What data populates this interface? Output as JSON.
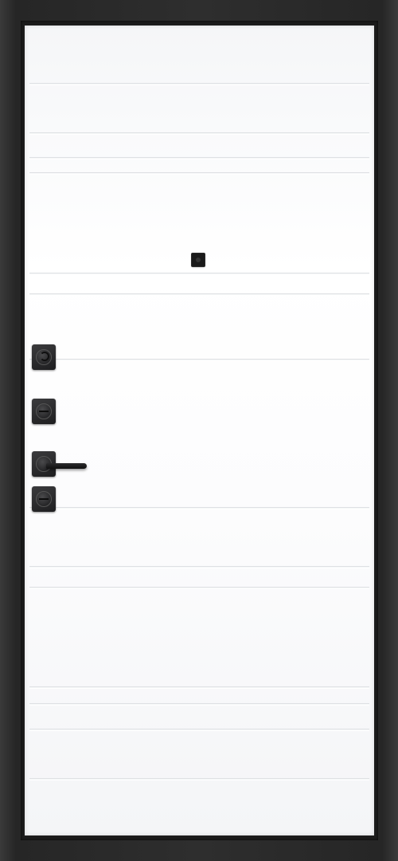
{
  "scene": {
    "subject": "door",
    "colors": {
      "frame": "#2b2b2b",
      "panel": "#ffffff",
      "hardware": "#1e1e20"
    },
    "hardware": [
      {
        "name": "night-latch-turn-knob",
        "icon": "turn-knob-icon"
      },
      {
        "name": "upper-lock-cylinder",
        "icon": "lock-cylinder-icon"
      },
      {
        "name": "lever-handle",
        "icon": "door-handle-icon"
      },
      {
        "name": "lower-lock-cylinder",
        "icon": "lock-cylinder-icon"
      }
    ]
  }
}
